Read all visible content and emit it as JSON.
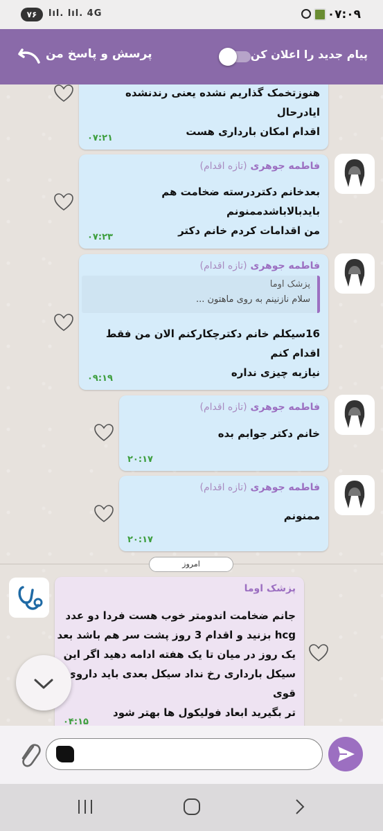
{
  "status_bar": {
    "time": "۰۷:۰۹",
    "battery": "۷۶",
    "network": "4G"
  },
  "header": {
    "title": "پرسش و پاسخ من",
    "notify_label": "پیام جدید را اعلان کن",
    "notify_enabled": false,
    "color": "#8a6aa9"
  },
  "messages": [
    {
      "text": "هنوزتخمک گذاریم نشده یعنی رندنشده ایادرحال\nاقدام امکان بارداری هست",
      "time": "۰۷:۲۱"
    },
    {
      "sender": "فاطمه جوهری",
      "sender_tag": "(تازه اقدام)",
      "text": "بعدخانم دکتردرسته ضخامت هم بایدبالاباشدممنونم\nمن اقدامات کردم خانم دکتر",
      "time": "۰۷:۲۳"
    },
    {
      "sender": "فاطمه جوهری",
      "sender_tag": "(تازه اقدام)",
      "quote_name": "پزشک اوما",
      "quote_text": "سلام نازنینم به روی ماهتون ...",
      "text": "16سیکلم خانم دکترچکارکنم الان من فقط اقدام کنم\nنیازبه چیزی نداره",
      "time": "۰۹:۱۹"
    },
    {
      "sender": "فاطمه جوهری",
      "sender_tag": "(تازه اقدام)",
      "text": "خانم دکتر جوابم بده",
      "time": "۲۰:۱۷"
    },
    {
      "sender": "فاطمه جوهری",
      "sender_tag": "(تازه اقدام)",
      "text": "ممنونم",
      "time": "۲۰:۱۷"
    },
    {
      "sender": "پزشک اوما",
      "text": "جانم ضخامت اندومتر خوب هست فردا دو عدد\nhcg بزنید و اقدام 3 روز پشت سر هم باشد بعد\nیک روز در میان تا یک هفته ادامه دهید اگر این\nسیکل بارداری رخ نداد سیکل بعدی باید داروی قوی\nتر بگیرید ابعاد فولیکول ها بهتر شود",
      "time": "۰۴:۱۵"
    }
  ],
  "date_divider": "امروز",
  "input": {
    "value": "",
    "placeholder": ""
  },
  "icons": {
    "back": "back-arrow-icon",
    "heart": "heart-icon",
    "attach": "paperclip-icon",
    "send": "send-icon",
    "scroll": "chevron-down-icon"
  }
}
